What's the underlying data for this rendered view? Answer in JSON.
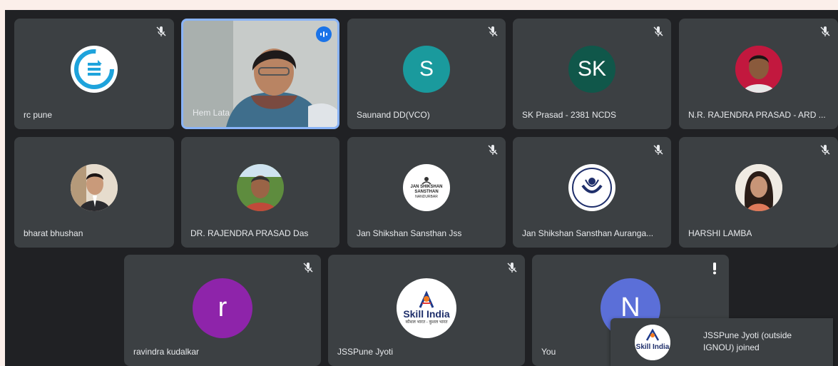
{
  "participants": [
    {
      "name": "rc pune",
      "muted": true,
      "avatar": "ignou-logo"
    },
    {
      "name": "Hem Lata",
      "muted": false,
      "speaking": true,
      "avatar": "video"
    },
    {
      "name": "Saunand DD(VCO)",
      "muted": true,
      "avatar_letter": "S"
    },
    {
      "name": "SK Prasad - 2381 NCDS",
      "muted": true,
      "avatar_letter": "SK"
    },
    {
      "name": "N.R. RAJENDRA PRASAD - ARD ...",
      "muted": true,
      "avatar": "photo"
    },
    {
      "name": "bharat bhushan",
      "muted": false,
      "avatar": "photo"
    },
    {
      "name": "DR. RAJENDRA PRASAD Das",
      "muted": false,
      "avatar": "photo"
    },
    {
      "name": "Jan Shikshan Sansthan Jss",
      "muted": true,
      "avatar": "jss-logo"
    },
    {
      "name": "Jan Shikshan Sansthan Auranga...",
      "muted": true,
      "avatar": "jss-round-logo"
    },
    {
      "name": "HARSHI LAMBA",
      "muted": true,
      "avatar": "photo"
    },
    {
      "name": "ravindra kudalkar",
      "muted": true,
      "avatar_letter": "r"
    },
    {
      "name": "JSSPune Jyoti",
      "muted": true,
      "avatar": "skill-india-logo"
    },
    {
      "name": "You",
      "muted": false,
      "alert": true,
      "avatar_letter": "N"
    }
  ],
  "jss_logo": {
    "line1": "JAN SHIKSHAN",
    "line2": "SANSTHAN",
    "line3": "NANDURBAR"
  },
  "jss_round_logo": {
    "text": "Jan Shikshan Sansthan"
  },
  "skill_india": {
    "text": "Skill India",
    "tagline": "कौशल भारत - कुशल भारत"
  },
  "toast": {
    "message": "JSSPune Jyoti (outside IGNOU) joined",
    "logo_text": "Skill India"
  },
  "colors": {
    "tile_bg": "#3c4043",
    "stage_bg": "#202124",
    "speaking_border": "#8ab4f8",
    "accent_blue": "#1a73e8"
  }
}
